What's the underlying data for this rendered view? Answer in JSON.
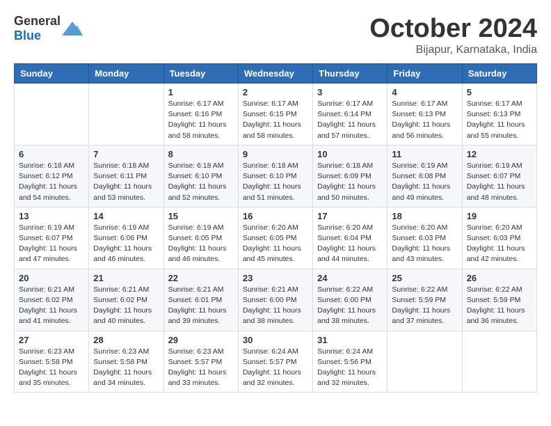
{
  "header": {
    "logo_general": "General",
    "logo_blue": "Blue",
    "month": "October 2024",
    "location": "Bijapur, Karnataka, India"
  },
  "weekdays": [
    "Sunday",
    "Monday",
    "Tuesday",
    "Wednesday",
    "Thursday",
    "Friday",
    "Saturday"
  ],
  "weeks": [
    [
      {
        "day": "",
        "info": ""
      },
      {
        "day": "",
        "info": ""
      },
      {
        "day": "1",
        "info": "Sunrise: 6:17 AM\nSunset: 6:16 PM\nDaylight: 11 hours and 58 minutes."
      },
      {
        "day": "2",
        "info": "Sunrise: 6:17 AM\nSunset: 6:15 PM\nDaylight: 11 hours and 58 minutes."
      },
      {
        "day": "3",
        "info": "Sunrise: 6:17 AM\nSunset: 6:14 PM\nDaylight: 11 hours and 57 minutes."
      },
      {
        "day": "4",
        "info": "Sunrise: 6:17 AM\nSunset: 6:13 PM\nDaylight: 11 hours and 56 minutes."
      },
      {
        "day": "5",
        "info": "Sunrise: 6:17 AM\nSunset: 6:13 PM\nDaylight: 11 hours and 55 minutes."
      }
    ],
    [
      {
        "day": "6",
        "info": "Sunrise: 6:18 AM\nSunset: 6:12 PM\nDaylight: 11 hours and 54 minutes."
      },
      {
        "day": "7",
        "info": "Sunrise: 6:18 AM\nSunset: 6:11 PM\nDaylight: 11 hours and 53 minutes."
      },
      {
        "day": "8",
        "info": "Sunrise: 6:18 AM\nSunset: 6:10 PM\nDaylight: 11 hours and 52 minutes."
      },
      {
        "day": "9",
        "info": "Sunrise: 6:18 AM\nSunset: 6:10 PM\nDaylight: 11 hours and 51 minutes."
      },
      {
        "day": "10",
        "info": "Sunrise: 6:18 AM\nSunset: 6:09 PM\nDaylight: 11 hours and 50 minutes."
      },
      {
        "day": "11",
        "info": "Sunrise: 6:19 AM\nSunset: 6:08 PM\nDaylight: 11 hours and 49 minutes."
      },
      {
        "day": "12",
        "info": "Sunrise: 6:19 AM\nSunset: 6:07 PM\nDaylight: 11 hours and 48 minutes."
      }
    ],
    [
      {
        "day": "13",
        "info": "Sunrise: 6:19 AM\nSunset: 6:07 PM\nDaylight: 11 hours and 47 minutes."
      },
      {
        "day": "14",
        "info": "Sunrise: 6:19 AM\nSunset: 6:06 PM\nDaylight: 11 hours and 46 minutes."
      },
      {
        "day": "15",
        "info": "Sunrise: 6:19 AM\nSunset: 6:05 PM\nDaylight: 11 hours and 46 minutes."
      },
      {
        "day": "16",
        "info": "Sunrise: 6:20 AM\nSunset: 6:05 PM\nDaylight: 11 hours and 45 minutes."
      },
      {
        "day": "17",
        "info": "Sunrise: 6:20 AM\nSunset: 6:04 PM\nDaylight: 11 hours and 44 minutes."
      },
      {
        "day": "18",
        "info": "Sunrise: 6:20 AM\nSunset: 6:03 PM\nDaylight: 11 hours and 43 minutes."
      },
      {
        "day": "19",
        "info": "Sunrise: 6:20 AM\nSunset: 6:03 PM\nDaylight: 11 hours and 42 minutes."
      }
    ],
    [
      {
        "day": "20",
        "info": "Sunrise: 6:21 AM\nSunset: 6:02 PM\nDaylight: 11 hours and 41 minutes."
      },
      {
        "day": "21",
        "info": "Sunrise: 6:21 AM\nSunset: 6:02 PM\nDaylight: 11 hours and 40 minutes."
      },
      {
        "day": "22",
        "info": "Sunrise: 6:21 AM\nSunset: 6:01 PM\nDaylight: 11 hours and 39 minutes."
      },
      {
        "day": "23",
        "info": "Sunrise: 6:21 AM\nSunset: 6:00 PM\nDaylight: 11 hours and 38 minutes."
      },
      {
        "day": "24",
        "info": "Sunrise: 6:22 AM\nSunset: 6:00 PM\nDaylight: 11 hours and 38 minutes."
      },
      {
        "day": "25",
        "info": "Sunrise: 6:22 AM\nSunset: 5:59 PM\nDaylight: 11 hours and 37 minutes."
      },
      {
        "day": "26",
        "info": "Sunrise: 6:22 AM\nSunset: 5:59 PM\nDaylight: 11 hours and 36 minutes."
      }
    ],
    [
      {
        "day": "27",
        "info": "Sunrise: 6:23 AM\nSunset: 5:58 PM\nDaylight: 11 hours and 35 minutes."
      },
      {
        "day": "28",
        "info": "Sunrise: 6:23 AM\nSunset: 5:58 PM\nDaylight: 11 hours and 34 minutes."
      },
      {
        "day": "29",
        "info": "Sunrise: 6:23 AM\nSunset: 5:57 PM\nDaylight: 11 hours and 33 minutes."
      },
      {
        "day": "30",
        "info": "Sunrise: 6:24 AM\nSunset: 5:57 PM\nDaylight: 11 hours and 32 minutes."
      },
      {
        "day": "31",
        "info": "Sunrise: 6:24 AM\nSunset: 5:56 PM\nDaylight: 11 hours and 32 minutes."
      },
      {
        "day": "",
        "info": ""
      },
      {
        "day": "",
        "info": ""
      }
    ]
  ]
}
